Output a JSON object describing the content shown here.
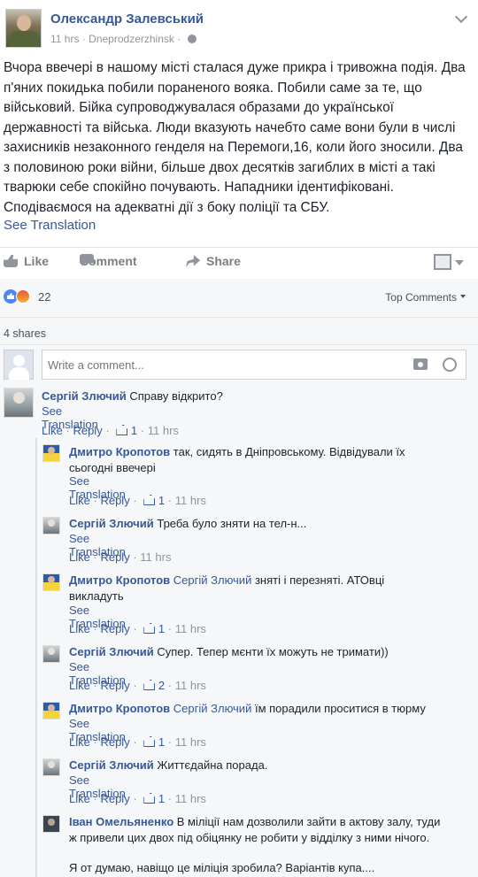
{
  "post": {
    "author": "Олександр Залевський",
    "time": "11 hrs",
    "location": "Dneprodzerzhinsk",
    "location_sep": "·",
    "text": "Вчора ввечері в нашому місті сталася дуже прикра і тривожна подія. Два п'яних покидька побили пораненого вояка. Побили саме за те, що військовий. Бійка супроводжувалася образами до української державності та війська. Люди вказують начебто саме вони були в числі захисників незаконного генделя на Перемоги,16, коли його зносили. Два з половиною роки війни, більше двох десятків загиблих в місті а такі тварюки себе спокійно почувають. Нападники ідентифіковані. Сподіваємося на адекватні дії з боку поліції та СБУ.",
    "see_translation": "See Translation"
  },
  "actions": {
    "like": "Like",
    "comment": "Comment",
    "share": "Share"
  },
  "reactions": {
    "count": "22",
    "sort_label": "Top Comments"
  },
  "shares": "4 shares",
  "composer": {
    "placeholder": "Write a comment..."
  },
  "footer_labels": {
    "like": "Like",
    "reply": "Reply",
    "dot": "·"
  },
  "comments": [
    {
      "name": "Сергій Злючий",
      "mention": "",
      "text": "Справу відкрито?",
      "translation": "See Translation",
      "likes": "1",
      "time": "11 hrs"
    },
    {
      "name": "Дмитро Кропотов",
      "mention": "",
      "text": "так, сидять в Дніпровському. Відвідували їх сьогодні ввечері",
      "translation": "See Translation",
      "likes": "1",
      "time": "11 hrs"
    },
    {
      "name": "Сергій Злючий",
      "mention": "",
      "text": "Треба було зняти на тел-н...",
      "translation": "See Translation",
      "likes": "",
      "time": "11 hrs"
    },
    {
      "name": "Дмитро Кропотов",
      "mention": "Сергій Злючий",
      "text": "зняті і перезняті. АТОвці викладуть",
      "translation": "See Translation",
      "likes": "1",
      "time": "11 hrs"
    },
    {
      "name": "Сергій Злючий",
      "mention": "",
      "text": "Супер. Тепер мєнти їх можуть не тримати))",
      "translation": "See Translation",
      "likes": "2",
      "time": "11 hrs"
    },
    {
      "name": "Дмитро Кропотов",
      "mention": "Сергій Злючий",
      "text": "їм порадили проситися в тюрму",
      "translation": "See Translation",
      "likes": "1",
      "time": "11 hrs"
    },
    {
      "name": "Сергій Злючий",
      "mention": "",
      "text": "Життєдайна порада.",
      "translation": "See Translation",
      "likes": "1",
      "time": "11 hrs"
    },
    {
      "name": "Іван Омельяненко",
      "mention": "",
      "text": "В міліції нам дозволили зайти в актову залу, туди ж привели цих двох під обіцянку не робити у відділку з ними нічого.",
      "text2": "Я от думаю, навіщо це міліція зробила? Варіантів купа....",
      "translation": "",
      "likes": "",
      "time": ""
    }
  ]
}
